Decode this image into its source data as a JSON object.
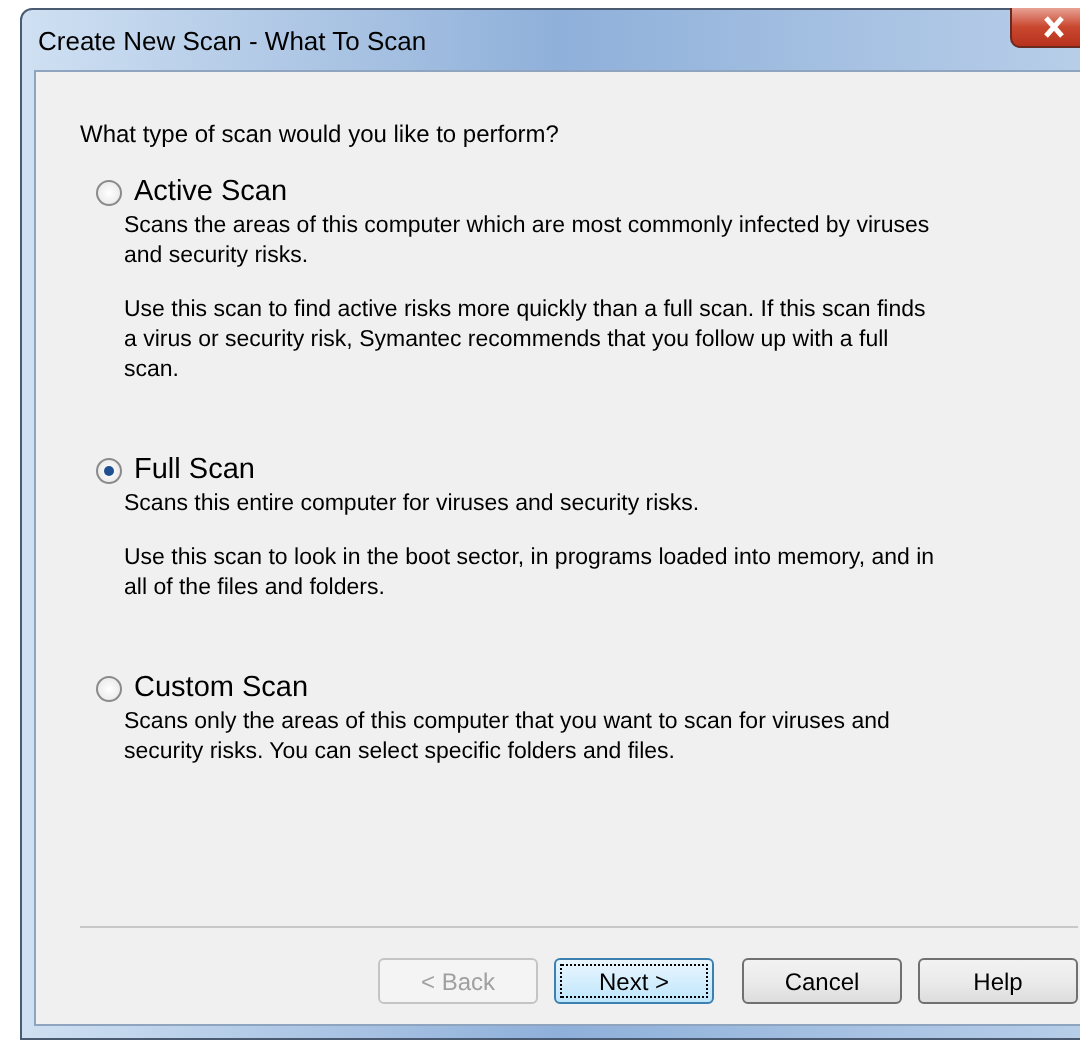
{
  "window": {
    "title": "Create New Scan - What To Scan"
  },
  "question": "What type of scan would you like to perform?",
  "options": [
    {
      "label": "Active Scan",
      "selected": false,
      "paragraphs": [
        "Scans the areas of this computer which are most commonly infected by viruses and security risks.",
        "Use this scan to find active risks more quickly than a full scan.  If this scan finds a virus or security risk, Symantec recommends that you follow up with a full scan."
      ]
    },
    {
      "label": "Full Scan",
      "selected": true,
      "paragraphs": [
        "Scans this entire computer for viruses and security risks.",
        "Use this scan to look in the boot sector, in programs loaded into memory, and in all of the files and folders."
      ]
    },
    {
      "label": "Custom Scan",
      "selected": false,
      "paragraphs": [
        "Scans only the areas of this computer that you want to scan for viruses and security risks.  You can select specific folders and files."
      ]
    }
  ],
  "buttons": [
    {
      "label": "< Back",
      "disabled": true,
      "default": false
    },
    {
      "label": "Next >",
      "disabled": false,
      "default": true
    },
    {
      "label": "Cancel",
      "disabled": false,
      "default": false
    },
    {
      "label": "Help",
      "disabled": false,
      "default": false
    }
  ]
}
